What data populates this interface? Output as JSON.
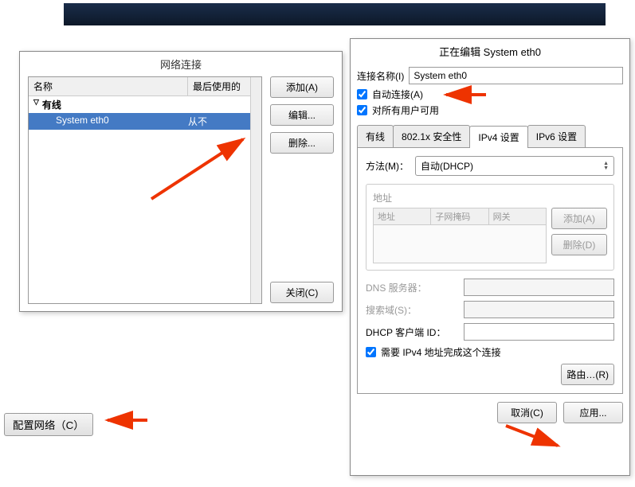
{
  "top_bar": {},
  "config_network_btn": "配置网络（C）",
  "dialog1": {
    "title": "网络连接",
    "columns": {
      "name": "名称",
      "last_used": "最后使用的"
    },
    "group": "有线",
    "connection": {
      "name": "System eth0",
      "last_used": "从不"
    },
    "buttons": {
      "add": "添加(A)",
      "edit": "编辑...",
      "delete": "删除...",
      "close": "关闭(C)"
    }
  },
  "dialog2": {
    "title": "正在编辑 System eth0",
    "conn_name_label": "连接名称(I)",
    "conn_name_value": "System eth0",
    "auto_connect": "自动连接(A)",
    "all_users": "对所有用户可用",
    "tabs": {
      "wired": "有线",
      "security": "802.1x 安全性",
      "ipv4": "IPv4 设置",
      "ipv6": "IPv6 设置"
    },
    "method_label": "方法(M)：",
    "method_value": "自动(DHCP)",
    "address_label": "地址",
    "addr_cols": {
      "addr": "地址",
      "mask": "子网掩码",
      "gw": "网关"
    },
    "addr_buttons": {
      "add": "添加(A)",
      "delete": "删除(D)"
    },
    "dns_label": "DNS 服务器：",
    "search_label": "搜索域(S)：",
    "dhcp_label": "DHCP 客户端 ID：",
    "require_ipv4": "需要 IPv4 地址完成这个连接",
    "routes_btn": "路由…(R)",
    "cancel": "取消(C)",
    "apply": "应用..."
  }
}
